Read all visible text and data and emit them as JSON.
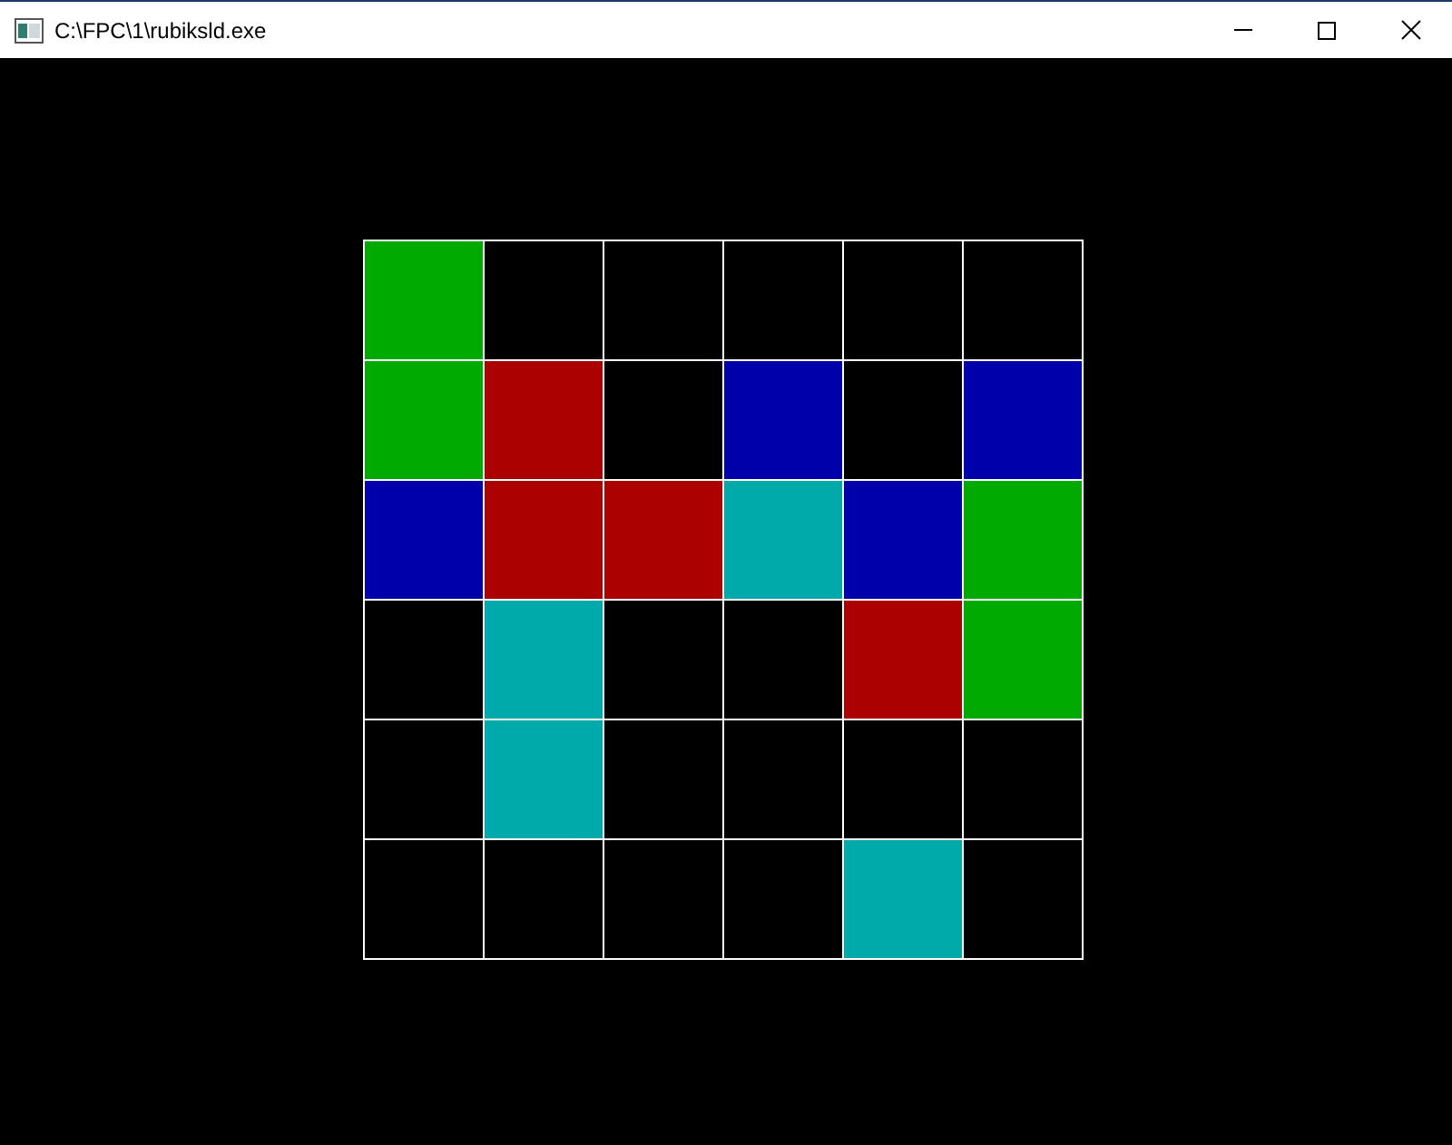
{
  "window": {
    "title": "C:\\FPC\\1\\rubiksld.exe"
  },
  "grid": {
    "rows": [
      {
        "cells": [
          {
            "color": "#00aa00"
          },
          {
            "color": "#000000"
          },
          {
            "color": "#000000"
          },
          {
            "color": "#000000"
          },
          {
            "color": "#000000"
          },
          {
            "color": "#000000"
          }
        ]
      },
      {
        "cells": [
          {
            "color": "#00aa00"
          },
          {
            "color": "#aa0000"
          },
          {
            "color": "#000000"
          },
          {
            "color": "#0000aa"
          },
          {
            "color": "#000000"
          },
          {
            "color": "#0000aa"
          }
        ]
      },
      {
        "cells": [
          {
            "color": "#0000aa"
          },
          {
            "color": "#aa0000"
          },
          {
            "color": "#aa0000"
          },
          {
            "color": "#00aaaa"
          },
          {
            "color": "#0000aa"
          },
          {
            "color": "#00aa00"
          }
        ]
      },
      {
        "cells": [
          {
            "color": "#000000"
          },
          {
            "color": "#00aaaa"
          },
          {
            "color": "#000000"
          },
          {
            "color": "#000000"
          },
          {
            "color": "#aa0000"
          },
          {
            "color": "#00aa00"
          }
        ]
      },
      {
        "cells": [
          {
            "color": "#000000"
          },
          {
            "color": "#00aaaa"
          },
          {
            "color": "#000000"
          },
          {
            "color": "#000000"
          },
          {
            "color": "#000000"
          },
          {
            "color": "#000000"
          }
        ]
      },
      {
        "cells": [
          {
            "color": "#000000"
          },
          {
            "color": "#000000"
          },
          {
            "color": "#000000"
          },
          {
            "color": "#000000"
          },
          {
            "color": "#00aaaa"
          },
          {
            "color": "#000000"
          }
        ]
      }
    ]
  }
}
